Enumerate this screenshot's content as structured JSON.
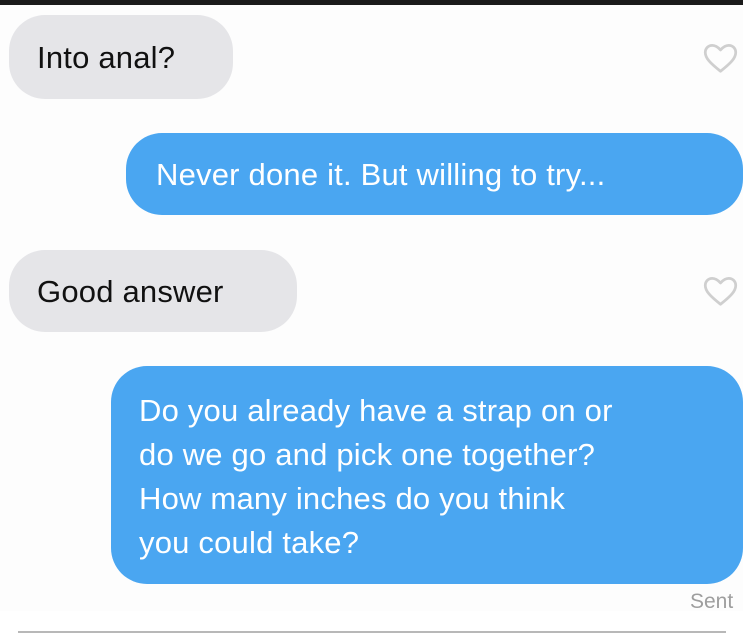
{
  "conversation": {
    "messages": [
      {
        "direction": "incoming",
        "text": "Into anal?"
      },
      {
        "direction": "outgoing",
        "text": "Never done it. But willing to try..."
      },
      {
        "direction": "incoming",
        "text": "Good answer"
      },
      {
        "direction": "outgoing",
        "text": "Do you already have a strap on or\ndo we go and pick one together?\nHow many inches do you think\nyou could take?"
      }
    ],
    "status": "Sent",
    "icons": {
      "like": "heart-outline-icon"
    },
    "colors": {
      "incoming_bubble": "#e5e5e8",
      "outgoing_bubble": "#4aa6f1",
      "outgoing_text": "#ffffff",
      "status_text": "#9e9e9e"
    }
  }
}
